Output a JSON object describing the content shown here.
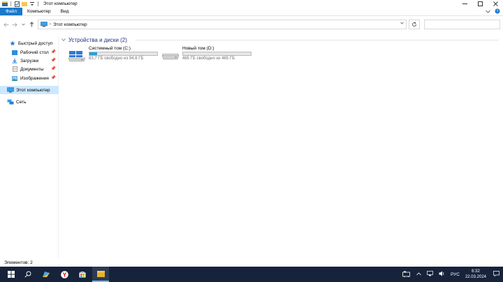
{
  "window": {
    "title": "Этот компьютер"
  },
  "ribbon": {
    "tabs": [
      {
        "label": "Файл"
      },
      {
        "label": "Компьютер"
      },
      {
        "label": "Вид"
      }
    ]
  },
  "address": {
    "path": "Этот компьютер"
  },
  "sidebar": {
    "items": [
      {
        "label": "Быстрый доступ",
        "icon": "star-icon"
      },
      {
        "label": "Рабочий стол",
        "icon": "desktop-icon",
        "pinned": true
      },
      {
        "label": "Загрузки",
        "icon": "download-icon",
        "pinned": true
      },
      {
        "label": "Документы",
        "icon": "documents-icon",
        "pinned": true
      },
      {
        "label": "Изображения",
        "icon": "pictures-icon",
        "pinned": true
      },
      {
        "label": "Этот компьютер",
        "icon": "computer-icon",
        "selected": true
      },
      {
        "label": "Сеть",
        "icon": "network-icon"
      }
    ]
  },
  "content": {
    "group_title": "Устройства и диски (2)",
    "drives": [
      {
        "name": "Системный том (C:)",
        "free_text": "83,7 ГБ свободно из 94,6 ГБ",
        "used_fraction": 0.115,
        "icon": "windows-drive-icon"
      },
      {
        "name": "Новый том (D:)",
        "free_text": "465 ГБ свободно из 465 ГБ",
        "used_fraction": 0.0,
        "icon": "hard-drive-icon"
      }
    ]
  },
  "status": {
    "items_count": "Элементов: 2"
  },
  "taskbar": {
    "language": "РУС",
    "time": "6:32",
    "date": "22.03.2024"
  },
  "colors": {
    "accent": "#1979ca",
    "drive_fill": "#26a0da",
    "taskbar": "#16233a",
    "selection": "#cce8ff"
  }
}
